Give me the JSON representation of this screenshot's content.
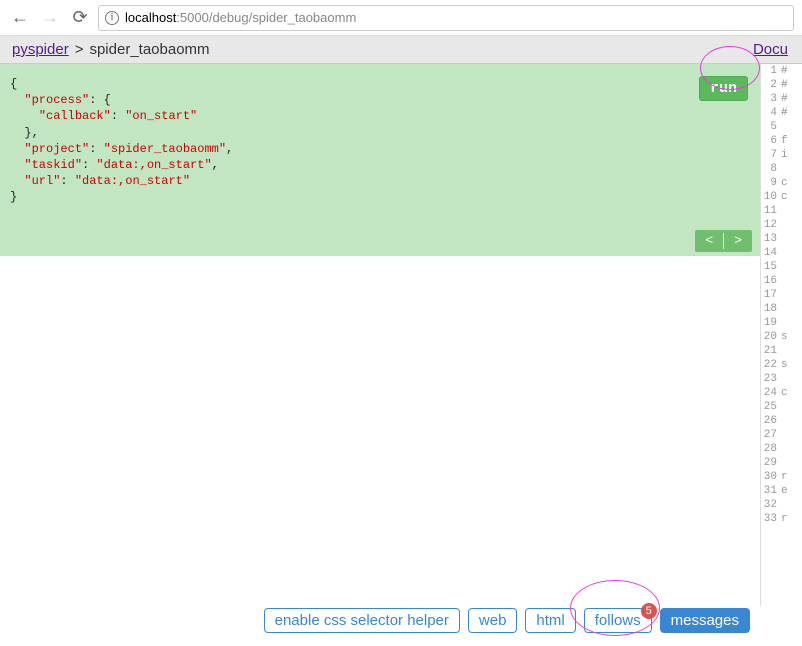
{
  "browser": {
    "url_host": "localhost",
    "url_path": ":5000/debug/spider_taobaomm"
  },
  "breadcrumb": {
    "root": "pyspider",
    "sep": ">",
    "current": "spider_taobaomm",
    "docs": "Docu"
  },
  "json_task": {
    "process_key": "\"process\"",
    "callback_key": "\"callback\"",
    "callback_val": "\"on_start\"",
    "project_key": "\"project\"",
    "project_val": "\"spider_taobaomm\"",
    "taskid_key": "\"taskid\"",
    "taskid_val": "\"data:,on_start\"",
    "url_key": "\"url\"",
    "url_val": "\"data:,on_start\""
  },
  "run_label": "run",
  "pager": {
    "prev": "<",
    "next": ">"
  },
  "code_lines": [
    "#",
    "#",
    "#",
    "#",
    "",
    "f",
    "i",
    "",
    "c",
    "c",
    "",
    "",
    "",
    "",
    "",
    "",
    "",
    "",
    "",
    "s",
    "",
    "s",
    "",
    "c",
    "",
    "",
    "",
    "",
    "",
    "r",
    "e",
    "",
    "r"
  ],
  "bottom": {
    "css_helper": "enable css selector helper",
    "web": "web",
    "html": "html",
    "follows": "follows",
    "follows_count": "5",
    "messages": "messages"
  }
}
